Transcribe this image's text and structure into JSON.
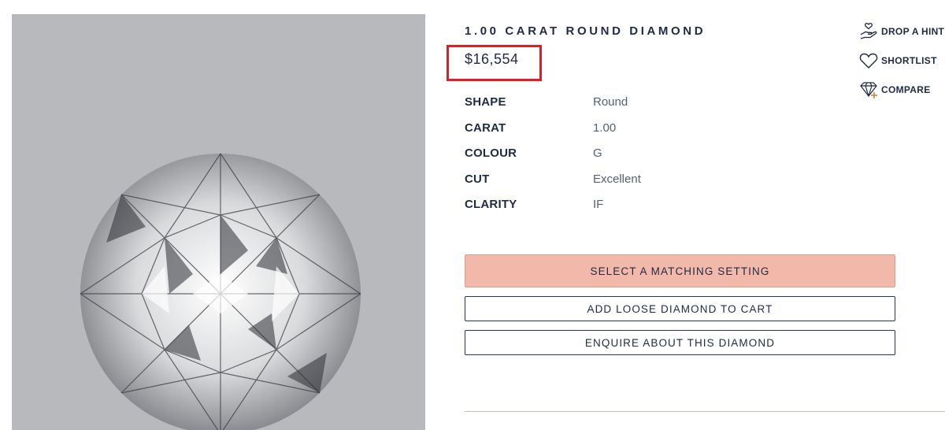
{
  "product": {
    "title": "1.00 CARAT ROUND DIAMOND",
    "price": "$16,554",
    "image_alt_icon": "round-diamond-photo"
  },
  "specs": [
    {
      "label": "SHAPE",
      "value": "Round"
    },
    {
      "label": "CARAT",
      "value": "1.00"
    },
    {
      "label": "COLOUR",
      "value": "G"
    },
    {
      "label": "CUT",
      "value": "Excellent"
    },
    {
      "label": "CLARITY",
      "value": "IF"
    }
  ],
  "buttons": {
    "select_setting": "SELECT A MATCHING SETTING",
    "add_to_cart": "ADD LOOSE DIAMOND TO CART",
    "enquire": "ENQUIRE ABOUT THIS DIAMOND"
  },
  "actions": [
    {
      "label": "DROP A HINT",
      "icon": "hand-heart-icon"
    },
    {
      "label": "SHORTLIST",
      "icon": "heart-icon"
    },
    {
      "label": "COMPARE",
      "icon": "diamond-plus-icon"
    }
  ],
  "colors": {
    "primary_button": "#f2b8aa",
    "text_navy": "#1f2a44",
    "highlight_box": "#e31b23",
    "image_background": "#b8b9bd"
  }
}
